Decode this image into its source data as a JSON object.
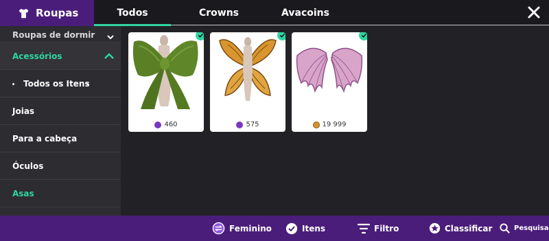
{
  "header": {
    "title": "Roupas",
    "tabs": [
      {
        "label": "Todos",
        "active": true
      },
      {
        "label": "Crowns",
        "active": false
      },
      {
        "label": "Avacoins",
        "active": false
      }
    ],
    "close_icon": "close-icon"
  },
  "sidebar": {
    "partial_item": "Roupas de dormir",
    "section": {
      "label": "Acessórios",
      "expanded": true
    },
    "items": [
      {
        "label": "Todos os Itens",
        "selected": true
      },
      {
        "label": "Joias"
      },
      {
        "label": "Para a cabeça"
      },
      {
        "label": "Óculos"
      },
      {
        "label": "Asas",
        "highlighted": true
      }
    ]
  },
  "items": [
    {
      "name": "green-bow",
      "price": "460",
      "currency": "crowns",
      "owned": true
    },
    {
      "name": "butterfly-wings",
      "price": "575",
      "currency": "crowns",
      "owned": true
    },
    {
      "name": "dragon-wings",
      "price": "19 999",
      "currency": "avacoins",
      "owned": true
    }
  ],
  "footer": {
    "gender": "Feminino",
    "items": "Itens",
    "filter": "Filtro",
    "sort": "Classificar",
    "search": "Pesquisa"
  },
  "colors": {
    "accent": "#2ed6a2",
    "brand_purple": "#4b1d7a",
    "background": "#222226",
    "sidebar": "#2c2c31"
  }
}
